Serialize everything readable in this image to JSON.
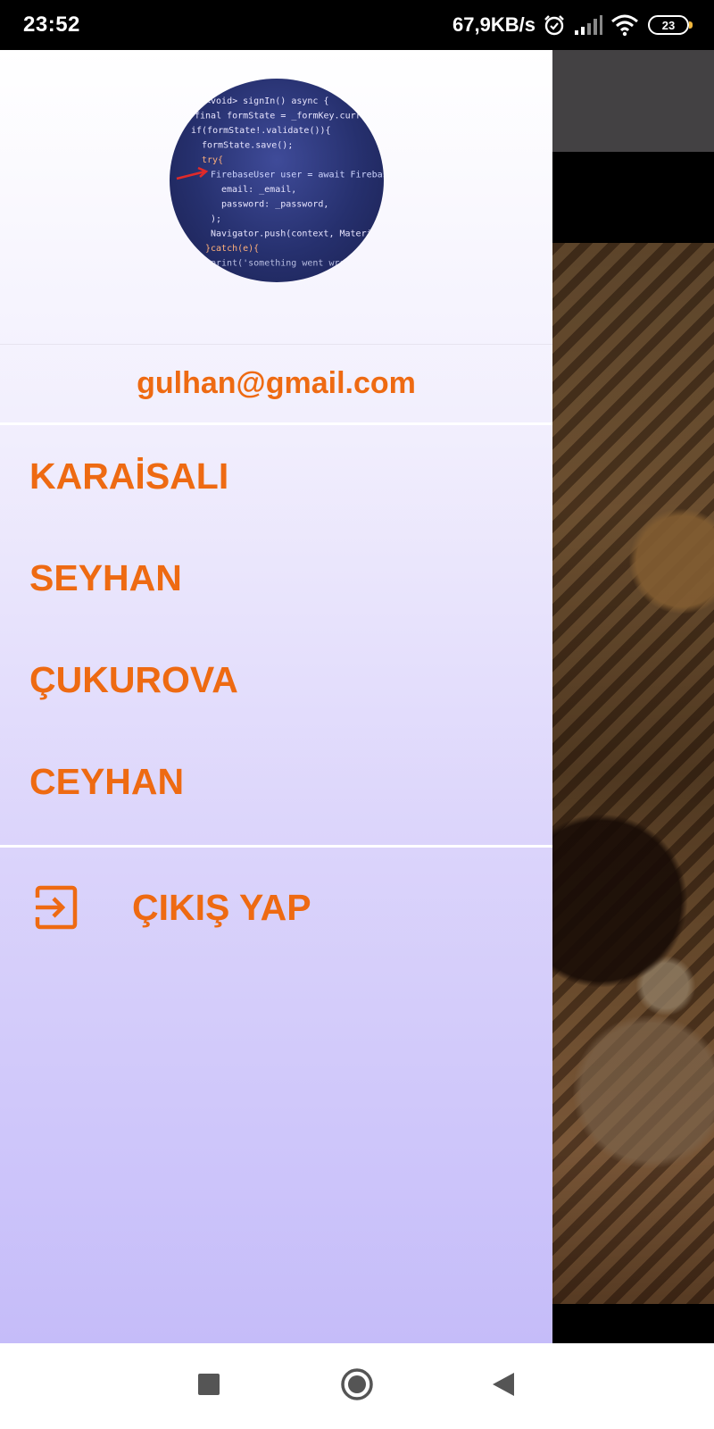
{
  "status_bar": {
    "time": "23:52",
    "network_speed": "67,9KB/s",
    "battery_level": "23",
    "icons": [
      "alarm-icon",
      "signal-icon",
      "wifi-icon",
      "battery-icon"
    ]
  },
  "drawer": {
    "email": "gulhan@gmail.com",
    "avatar_code_lines": [
      "<void> signIn() async {",
      "final formState = _formKey.current",
      "if(formState!.validate()){",
      "formState.save();",
      "try{",
      "FirebaseUser user =  await Firebase",
      "email: _email,",
      "password: _password,",
      ");",
      "Navigator.push(context, MaterialPa",
      "}catch(e){",
      "print('something went wrong')"
    ],
    "menu_items": [
      {
        "label": "KARAİSALI"
      },
      {
        "label": "SEYHAN"
      },
      {
        "label": "ÇUKUROVA"
      },
      {
        "label": "CEYHAN"
      }
    ],
    "logout": {
      "label": "ÇIKIŞ YAP",
      "icon": "logout-icon"
    }
  },
  "nav_bar": {
    "buttons": [
      "recents-icon",
      "home-icon",
      "back-icon"
    ]
  },
  "colors": {
    "accent": "#ee6a12",
    "drawer_top": "#ffffff",
    "drawer_bottom": "#c5bcf9",
    "status_bar": "#000000"
  }
}
